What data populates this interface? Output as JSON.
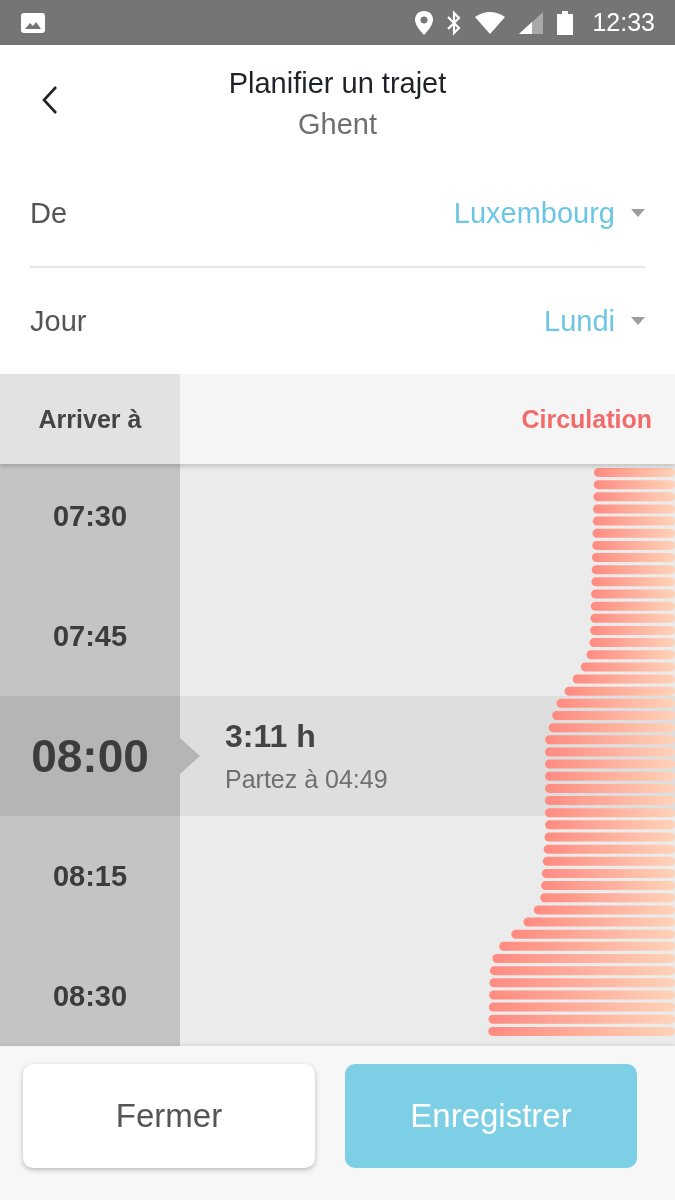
{
  "status_bar": {
    "time": "12:33"
  },
  "header": {
    "title": "Planifier un trajet",
    "subtitle": "Ghent"
  },
  "fields": [
    {
      "label": "De",
      "value": "Luxembourg"
    },
    {
      "label": "Jour",
      "value": "Lundi"
    }
  ],
  "table": {
    "columns": [
      "Arriver à",
      "Circulation"
    ],
    "rows": [
      {
        "time": "07:30",
        "selected": false
      },
      {
        "time": "07:45",
        "selected": false
      },
      {
        "time": "08:00",
        "selected": true,
        "duration": "3:11 h",
        "departure": "Partez à 04:49"
      },
      {
        "time": "08:15",
        "selected": false
      },
      {
        "time": "08:30",
        "selected": false
      }
    ]
  },
  "buttons": [
    {
      "label": "Fermer",
      "kind": "secondary"
    },
    {
      "label": "Enregistrer",
      "kind": "primary"
    }
  ]
}
